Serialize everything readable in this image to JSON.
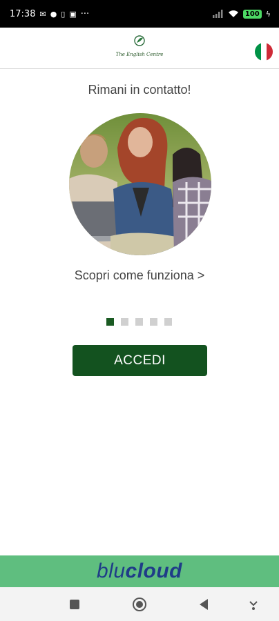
{
  "status_bar": {
    "time": "17:38",
    "more_indicator": "···",
    "battery": "100",
    "icons": [
      "signal-icon",
      "wifi-icon",
      "battery-icon",
      "charging-icon"
    ]
  },
  "header": {
    "logo_text": "The English Centre",
    "language": "Italiano"
  },
  "content": {
    "title": "Rimani in contatto!",
    "link_label": "Scopri come funziona >",
    "pager": {
      "count": 5,
      "active_index": 0
    },
    "login_button": "ACCEDI"
  },
  "footer": {
    "brand_light": "blu",
    "brand_bold": "cloud"
  },
  "colors": {
    "primary": "#13521f",
    "footer_bg": "#5fbe7f",
    "brand_blue": "#1f3c88"
  }
}
